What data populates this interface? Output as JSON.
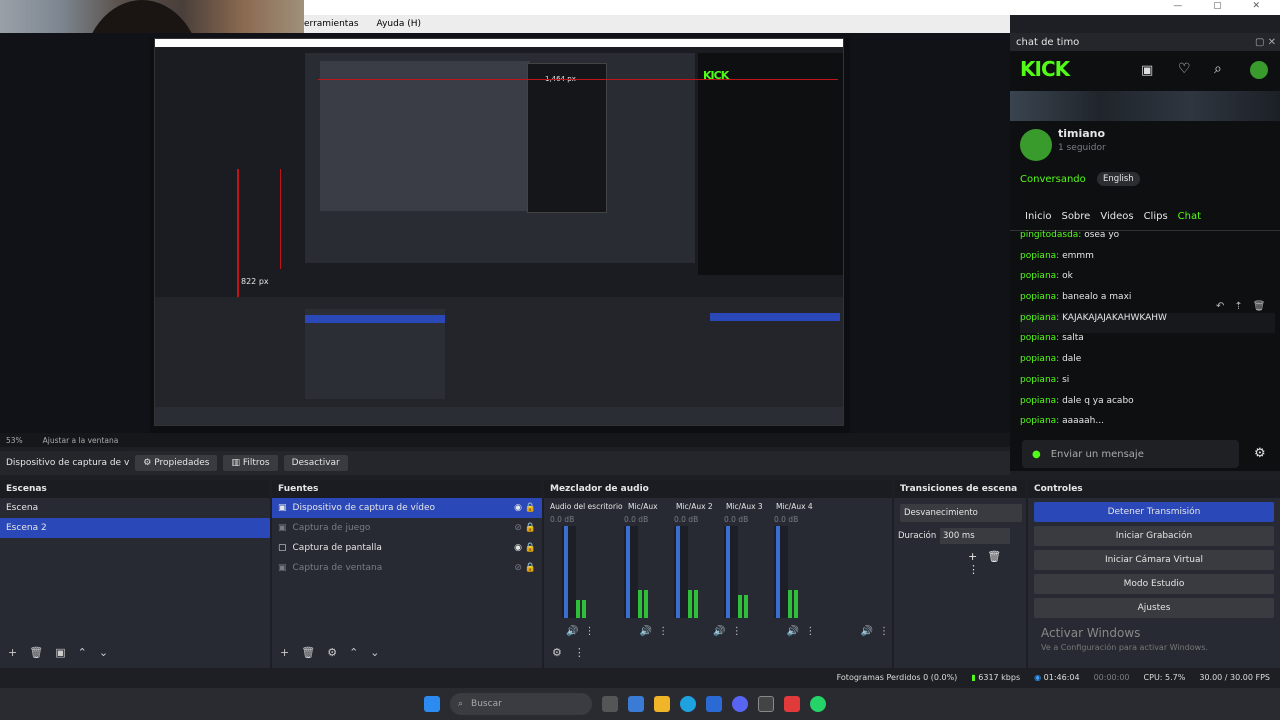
{
  "window": {
    "controls": "—  ▢  ✕"
  },
  "menu": {
    "items": [
      "erramientas",
      "Ayuda (H)"
    ]
  },
  "nested_preview": {
    "label_px": "822 px",
    "label_px2": "1,464 px"
  },
  "chat": {
    "window_title": "chat de timo",
    "brand": "KICK",
    "channel": "timiano",
    "followers": "1 seguidor",
    "status": "Conversando",
    "language": "English",
    "tabs": [
      "Inicio",
      "Sobre",
      "Videos",
      "Clips",
      "Chat"
    ],
    "messages": [
      {
        "user": "pingitodasda:",
        "text": " osea yo"
      },
      {
        "user": "popiana:",
        "text": " emmm"
      },
      {
        "user": "popiana:",
        "text": " ok"
      },
      {
        "user": "popiana:",
        "text": " banealo a maxi"
      },
      {
        "user": "popiana:",
        "text": " KAJAKAJAJAKAHWKAHW"
      },
      {
        "user": "popiana:",
        "text": " salta"
      },
      {
        "user": "popiana:",
        "text": " dale"
      },
      {
        "user": "popiana:",
        "text": " si"
      },
      {
        "user": "popiana:",
        "text": " dale q ya acabo"
      },
      {
        "user": "popiana:",
        "text": " aaaaah..."
      }
    ],
    "input_placeholder": "Enviar un mensaje"
  },
  "zoom": {
    "level": "53%",
    "fit": "Ajustar a la ventana"
  },
  "props": {
    "source": "Dispositivo de captura de v",
    "properties": "Propiedades",
    "filters": "Filtros",
    "deactivate": "Desactivar"
  },
  "scenes": {
    "title": "Escenas",
    "items": [
      "Escena",
      "Escena 2"
    ],
    "selected": 1
  },
  "sources": {
    "title": "Fuentes",
    "items": [
      {
        "name": "Dispositivo de captura de vídeo",
        "active": true
      },
      {
        "name": "Captura de juego",
        "active": false
      },
      {
        "name": "Captura de pantalla",
        "active": true
      },
      {
        "name": "Captura de ventana",
        "active": false
      }
    ]
  },
  "mixer": {
    "title": "Mezclador de audio",
    "channels": [
      {
        "name": "Audio del escritorio",
        "db": "0.0 dB",
        "level": 0.2
      },
      {
        "name": "Mic/Aux",
        "db": "0.0 dB",
        "level": 0.3
      },
      {
        "name": "Mic/Aux 2",
        "db": "0.0 dB",
        "level": 0.3
      },
      {
        "name": "Mic/Aux 3",
        "db": "0.0 dB",
        "level": 0.25
      },
      {
        "name": "Mic/Aux 4",
        "db": "0.0 dB",
        "level": 0.3
      }
    ],
    "ticks": [
      "0",
      "-5",
      "-10",
      "-15",
      "-20",
      "-25",
      "-30",
      "-35",
      "-40",
      "-45",
      "-50",
      "-55",
      "-60"
    ]
  },
  "transitions": {
    "title": "Transiciones de escena",
    "selected": "Desvanecimiento",
    "duration_label": "Duración",
    "duration": "300 ms"
  },
  "controls": {
    "title": "Controles",
    "buttons": [
      "Detener Transmisión",
      "Iniciar Grabación",
      "Iniciar Cámara Virtual",
      "Modo Estudio",
      "Ajustes"
    ]
  },
  "watermark": {
    "line1": "Activar Windows",
    "line2": "Ve a Configuración para activar Windows."
  },
  "status": {
    "dropped": "Fotogramas Perdidos 0 (0.0%)",
    "bitrate": "6317 kbps",
    "live": "01:46:04",
    "rec": "00:00:00",
    "cpu": "CPU: 5.7%",
    "fps": "30.00 / 30.00 FPS"
  },
  "taskbar": {
    "search": "Buscar"
  }
}
